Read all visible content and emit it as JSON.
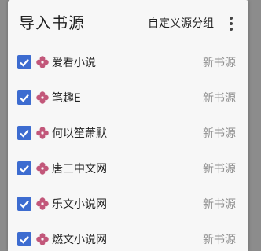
{
  "dialog": {
    "title": "导入书源",
    "custom_group_label": "自定义源分组",
    "more_icon": "more-vert-icon"
  },
  "colors": {
    "checkbox": "#3d6cd0",
    "source_icon": "#c2577a",
    "status_text": "#8f8f8f"
  },
  "sources": [
    {
      "name": "爱看小说",
      "status": "新书源",
      "checked": true
    },
    {
      "name": "笔趣E",
      "status": "新书源",
      "checked": true
    },
    {
      "name": "何以笙萧默",
      "status": "新书源",
      "checked": true
    },
    {
      "name": "唐三中文网",
      "status": "新书源",
      "checked": true
    },
    {
      "name": "乐文小说网",
      "status": "新书源",
      "checked": true
    },
    {
      "name": "燃文小说网",
      "status": "新书源",
      "checked": true
    }
  ]
}
